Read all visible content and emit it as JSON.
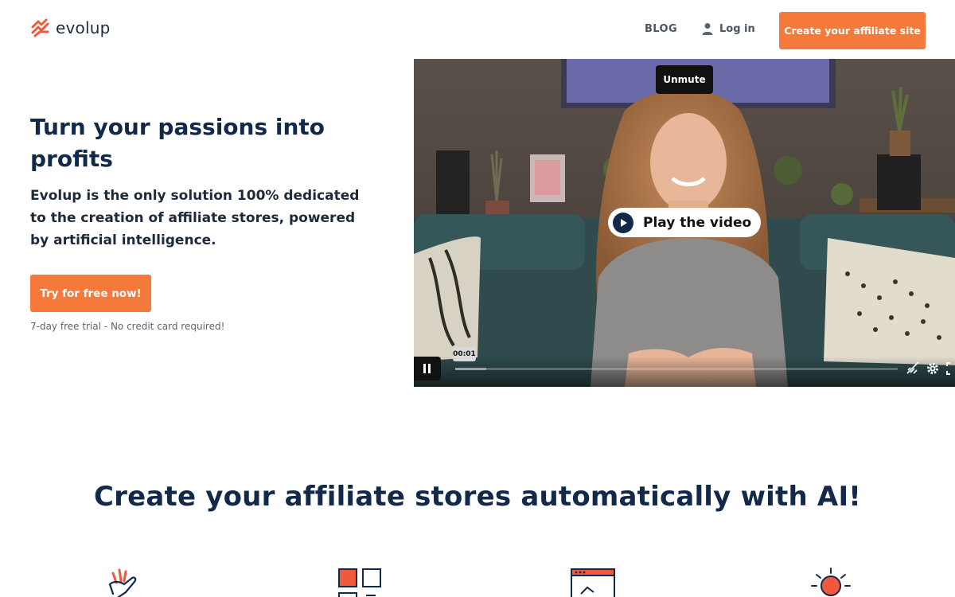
{
  "header": {
    "logo_text": "evolup",
    "nav_blog": "BLOG",
    "nav_login": "Log in",
    "cta": "Create your affiliate site"
  },
  "hero": {
    "title": "Turn your passions into profits",
    "description": "Evolup is the only solution 100% dedicated to the creation of affiliate stores, powered by artificial intelligence.",
    "cta": "Try for free now!",
    "note": "7-day free trial - No credit card required!"
  },
  "video": {
    "unmute_label": "Unmute",
    "play_label": "Play the video",
    "current_time": "00:01",
    "progress": 0.07
  },
  "features": {
    "title": "Create your affiliate stores automatically with AI!",
    "icons": [
      "fingers-icon",
      "grid-icon",
      "browser-icon",
      "lightbulb-icon"
    ]
  },
  "colors": {
    "accent": "#f6793c",
    "navy": "#13294a"
  }
}
